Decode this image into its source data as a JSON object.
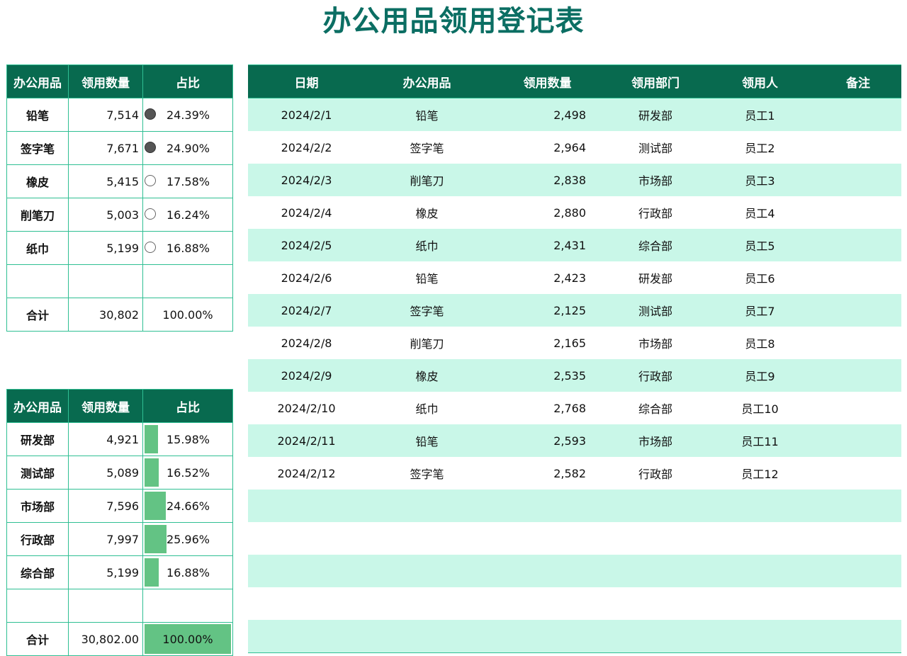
{
  "title": "办公用品领用登记表",
  "colors": {
    "header_bg": "#086a4f",
    "title": "#0b6e63",
    "stripe": "#c9f7e8",
    "border": "#2fbf93",
    "bar": "#63c384",
    "dot_full": "#555555"
  },
  "item_summary": {
    "headers": [
      "办公用品",
      "领用数量",
      "占比"
    ],
    "rows": [
      {
        "name": "铅笔",
        "qty": "7,514",
        "pct": "24.39%",
        "indicator": "full-circle"
      },
      {
        "name": "签字笔",
        "qty": "7,671",
        "pct": "24.90%",
        "indicator": "full-circle"
      },
      {
        "name": "橡皮",
        "qty": "5,415",
        "pct": "17.58%",
        "indicator": "empty-circle"
      },
      {
        "name": "削笔刀",
        "qty": "5,003",
        "pct": "16.24%",
        "indicator": "empty-circle"
      },
      {
        "name": "纸巾",
        "qty": "5,199",
        "pct": "16.88%",
        "indicator": "empty-circle"
      }
    ],
    "total": {
      "name": "合计",
      "qty": "30,802",
      "pct": "100.00%"
    }
  },
  "dept_summary": {
    "headers": [
      "办公用品",
      "领用数量",
      "占比"
    ],
    "rows": [
      {
        "name": "研发部",
        "qty": "4,921",
        "pct": "15.98%",
        "bar_fraction": 0.1598
      },
      {
        "name": "测试部",
        "qty": "5,089",
        "pct": "16.52%",
        "bar_fraction": 0.1652
      },
      {
        "name": "市场部",
        "qty": "7,596",
        "pct": "24.66%",
        "bar_fraction": 0.2466
      },
      {
        "name": "行政部",
        "qty": "7,997",
        "pct": "25.96%",
        "bar_fraction": 0.2596
      },
      {
        "name": "综合部",
        "qty": "5,199",
        "pct": "16.88%",
        "bar_fraction": 0.1688
      }
    ],
    "total": {
      "name": "合计",
      "qty": "30,802.00",
      "pct": "100.00%",
      "bar_fraction": 1.0
    }
  },
  "log": {
    "headers": [
      "日期",
      "办公用品",
      "领用数量",
      "领用部门",
      "领用人",
      "备注"
    ],
    "rows": [
      [
        "2024/2/1",
        "铅笔",
        "2,498",
        "研发部",
        "员工1",
        ""
      ],
      [
        "2024/2/2",
        "签字笔",
        "2,964",
        "测试部",
        "员工2",
        ""
      ],
      [
        "2024/2/3",
        "削笔刀",
        "2,838",
        "市场部",
        "员工3",
        ""
      ],
      [
        "2024/2/4",
        "橡皮",
        "2,880",
        "行政部",
        "员工4",
        ""
      ],
      [
        "2024/2/5",
        "纸巾",
        "2,431",
        "综合部",
        "员工5",
        ""
      ],
      [
        "2024/2/6",
        "铅笔",
        "2,423",
        "研发部",
        "员工6",
        ""
      ],
      [
        "2024/2/7",
        "签字笔",
        "2,125",
        "测试部",
        "员工7",
        ""
      ],
      [
        "2024/2/8",
        "削笔刀",
        "2,165",
        "市场部",
        "员工8",
        ""
      ],
      [
        "2024/2/9",
        "橡皮",
        "2,535",
        "行政部",
        "员工9",
        ""
      ],
      [
        "2024/2/10",
        "纸巾",
        "2,768",
        "综合部",
        "员工10",
        ""
      ],
      [
        "2024/2/11",
        "铅笔",
        "2,593",
        "市场部",
        "员工11",
        ""
      ],
      [
        "2024/2/12",
        "签字笔",
        "2,582",
        "行政部",
        "员工12",
        ""
      ],
      [
        "",
        "",
        "",
        "",
        "",
        ""
      ],
      [
        "",
        "",
        "",
        "",
        "",
        ""
      ],
      [
        "",
        "",
        "",
        "",
        "",
        ""
      ],
      [
        "",
        "",
        "",
        "",
        "",
        ""
      ],
      [
        "",
        "",
        "",
        "",
        "",
        ""
      ]
    ]
  }
}
